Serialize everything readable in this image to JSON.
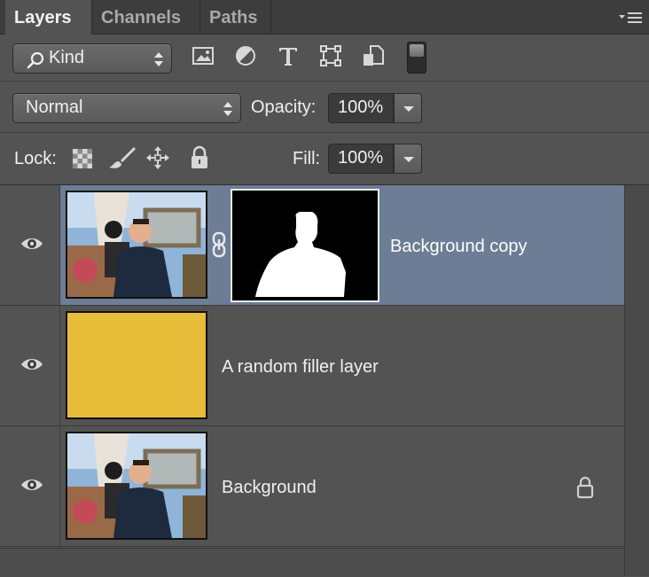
{
  "tabs": [
    {
      "label": "Layers",
      "active": true
    },
    {
      "label": "Channels",
      "active": false
    },
    {
      "label": "Paths",
      "active": false
    }
  ],
  "filter": {
    "kind_label": "Kind",
    "icons": [
      "image-filter-icon",
      "adjustment-filter-icon",
      "type-filter-icon",
      "shape-filter-icon",
      "smart-object-filter-icon"
    ]
  },
  "blend": {
    "mode": "Normal",
    "opacity_label": "Opacity:",
    "opacity_value": "100%"
  },
  "lock": {
    "label": "Lock:",
    "icons": [
      "lock-transparent-pixels-icon",
      "lock-image-pixels-icon",
      "lock-position-icon",
      "lock-all-icon"
    ],
    "fill_label": "Fill:",
    "fill_value": "100%"
  },
  "layers": [
    {
      "name": "Background copy",
      "selected": true,
      "visible": true,
      "has_mask": true,
      "locked": false
    },
    {
      "name": "A random filler layer",
      "selected": false,
      "visible": true,
      "fill_color": "#e8bd3a",
      "locked": false
    },
    {
      "name": "Background",
      "selected": false,
      "visible": true,
      "locked": true
    }
  ],
  "colors": {
    "panel_bg": "#535353",
    "selected_row": "#6c7d95",
    "filler_yellow": "#e8bd3a"
  }
}
